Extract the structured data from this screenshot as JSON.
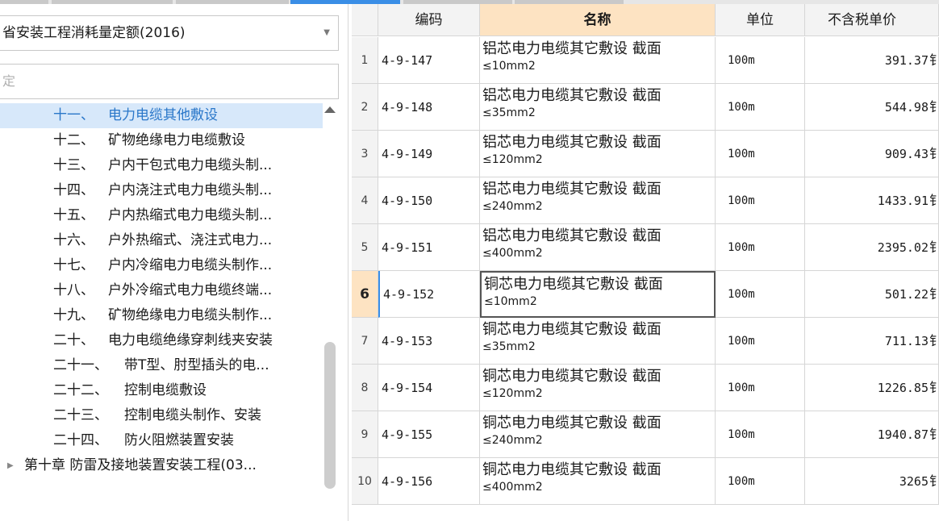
{
  "library": {
    "selected": "省安装工程消耗量定额(2016)"
  },
  "search": {
    "placeholder": "定"
  },
  "tree": {
    "items": [
      {
        "num": "十一、",
        "label": "电力电缆其他敷设",
        "selected": true
      },
      {
        "num": "十二、",
        "label": "矿物绝缘电力电缆敷设"
      },
      {
        "num": "十三、",
        "label": "户内干包式电力电缆头制..."
      },
      {
        "num": "十四、",
        "label": "户内浇注式电力电缆头制..."
      },
      {
        "num": "十五、",
        "label": "户内热缩式电力电缆头制..."
      },
      {
        "num": "十六、",
        "label": "户外热缩式、浇注式电力..."
      },
      {
        "num": "十七、",
        "label": "户内冷缩电力电缆头制作..."
      },
      {
        "num": "十八、",
        "label": "户外冷缩式电力电缆终端..."
      },
      {
        "num": "十九、",
        "label": "矿物绝缘电力电缆头制作..."
      },
      {
        "num": "二十、",
        "label": "电力电缆绝缘穿刺线夹安装"
      },
      {
        "num": "二十一、",
        "label": "带T型、肘型插头的电..."
      },
      {
        "num": "二十二、",
        "label": "控制电缆敷设"
      },
      {
        "num": "二十三、",
        "label": "控制电缆头制作、安装"
      },
      {
        "num": "二十四、",
        "label": "防火阻燃装置安装"
      }
    ],
    "chapter": "第十章 防雷及接地装置安装工程(03..."
  },
  "grid": {
    "headers": {
      "code": "编码",
      "name": "名称",
      "unit": "单位",
      "price": "不含税单价"
    },
    "rows": [
      {
        "idx": "1",
        "code": "4-9-147",
        "name1": "铝芯电力电缆其它敷设 截面",
        "name2": "≤10mm2",
        "unit": "100m",
        "price": "391.37"
      },
      {
        "idx": "2",
        "code": "4-9-148",
        "name1": "铝芯电力电缆其它敷设 截面",
        "name2": "≤35mm2",
        "unit": "100m",
        "price": "544.98"
      },
      {
        "idx": "3",
        "code": "4-9-149",
        "name1": "铝芯电力电缆其它敷设 截面",
        "name2": "≤120mm2",
        "unit": "100m",
        "price": "909.43"
      },
      {
        "idx": "4",
        "code": "4-9-150",
        "name1": "铝芯电力电缆其它敷设 截面",
        "name2": "≤240mm2",
        "unit": "100m",
        "price": "1433.91"
      },
      {
        "idx": "5",
        "code": "4-9-151",
        "name1": "铝芯电力电缆其它敷设 截面",
        "name2": "≤400mm2",
        "unit": "100m",
        "price": "2395.02"
      },
      {
        "idx": "6",
        "code": "4-9-152",
        "name1": "铜芯电力电缆其它敷设 截面",
        "name2": "≤10mm2",
        "unit": "100m",
        "price": "501.22",
        "current": true
      },
      {
        "idx": "7",
        "code": "4-9-153",
        "name1": "铜芯电力电缆其它敷设 截面",
        "name2": "≤35mm2",
        "unit": "100m",
        "price": "711.13"
      },
      {
        "idx": "8",
        "code": "4-9-154",
        "name1": "铜芯电力电缆其它敷设 截面",
        "name2": "≤120mm2",
        "unit": "100m",
        "price": "1226.85"
      },
      {
        "idx": "9",
        "code": "4-9-155",
        "name1": "铜芯电力电缆其它敷设 截面",
        "name2": "≤240mm2",
        "unit": "100m",
        "price": "1940.87"
      },
      {
        "idx": "10",
        "code": "4-9-156",
        "name1": "铜芯电力电缆其它敷设 截面",
        "name2": "≤400mm2",
        "unit": "100m",
        "price": "3265"
      }
    ],
    "price_overflow_glyph": "钅"
  },
  "colors": {
    "accent": "#3a8ee6",
    "selected_bg": "#d7e8fa",
    "header_highlight": "#fde3c2"
  }
}
